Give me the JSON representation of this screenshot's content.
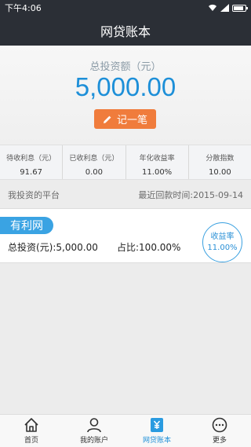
{
  "status_bar": {
    "time": "下午4:06"
  },
  "app_bar": {
    "title": "网贷账本"
  },
  "hero": {
    "label": "总投资额（元）",
    "amount": "5,000.00",
    "record_button": "记一笔"
  },
  "stats": [
    {
      "label": "待收利息（元）",
      "value": "91.67"
    },
    {
      "label": "已收利息（元）",
      "value": "0.00"
    },
    {
      "label": "年化收益率",
      "value": "11.00%"
    },
    {
      "label": "分散指数",
      "value": "10.00"
    }
  ],
  "section": {
    "title": "我投资的平台",
    "recent_label": "最近回款时间:2015-09-14"
  },
  "platform": {
    "name": "有利网",
    "total": "总投资(元):5,000.00",
    "share": "占比:100.00%",
    "yield_label": "收益率",
    "yield_value": "11.00%"
  },
  "tabbar": [
    {
      "label": "首页",
      "icon": "home-icon"
    },
    {
      "label": "我的账户",
      "icon": "user-icon"
    },
    {
      "label": "网贷账本",
      "icon": "ledger-icon"
    },
    {
      "label": "更多",
      "icon": "more-icon"
    }
  ],
  "colors": {
    "accent": "#1d8fd8",
    "button": "#f07c3c",
    "dark_bar": "#2b2f36"
  }
}
